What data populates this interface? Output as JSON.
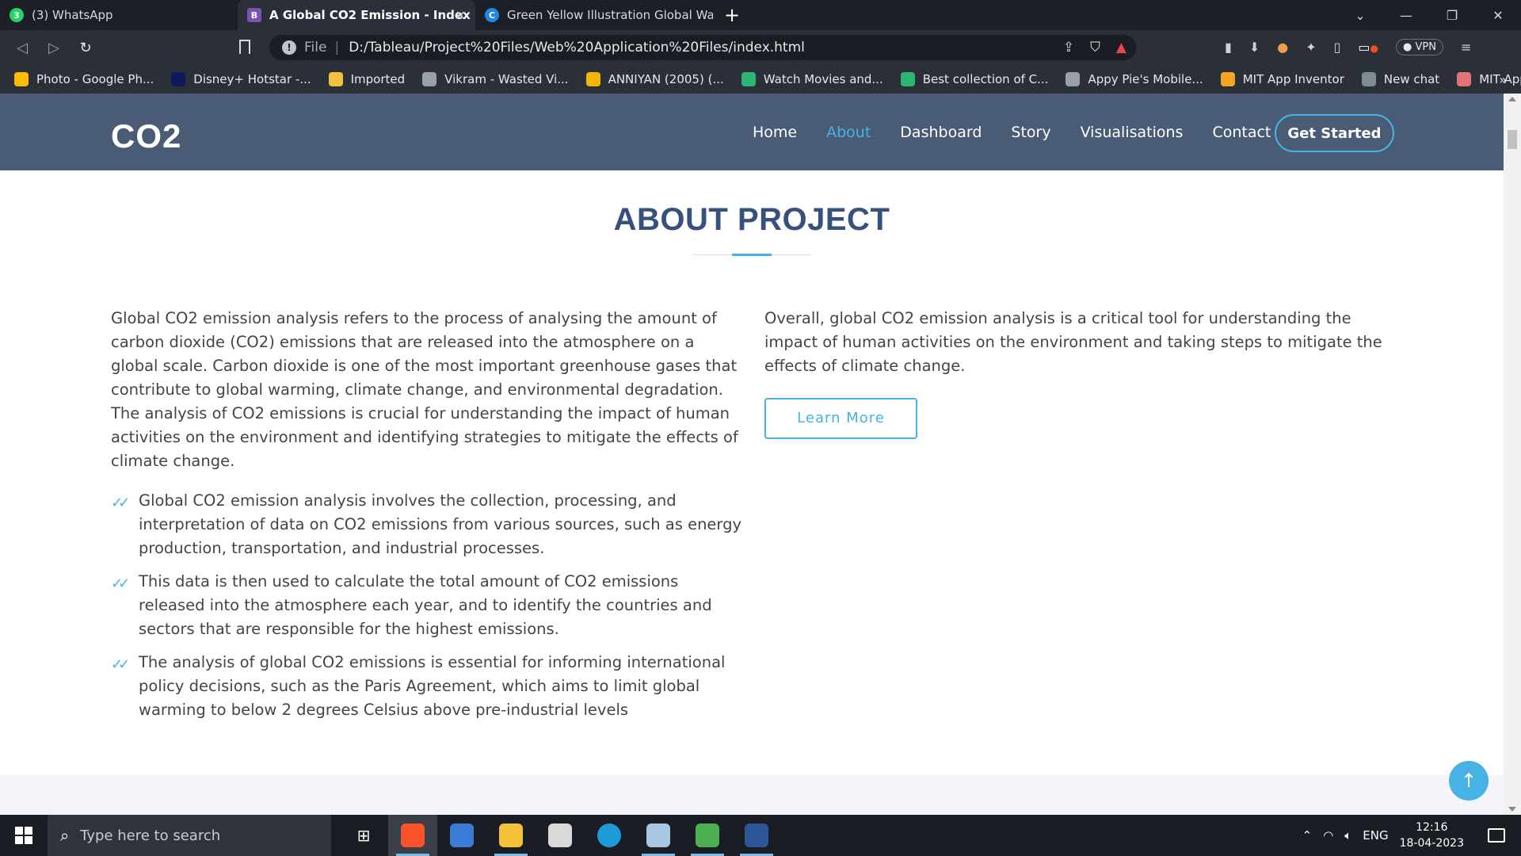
{
  "browser": {
    "tabs": [
      {
        "label": "(3) WhatsApp",
        "icon": "whatsapp-icon",
        "color": "#25d366",
        "glyph": "3"
      },
      {
        "label": "A Global CO2 Emission - Index",
        "icon": "bootstrap-icon",
        "color": "#7952b3",
        "glyph": "B",
        "active": true
      },
      {
        "label": "Green Yellow Illustration Global Warmi",
        "icon": "canva-icon",
        "color": "#1e88e5",
        "glyph": "C"
      }
    ],
    "new_tab": "+",
    "url_scheme": "File",
    "url": "D:/Tableau/Project%20Files/Web%20Application%20Files/index.html",
    "vpn_label": "VPN",
    "bookmarks": [
      {
        "label": "Photo - Google Ph...",
        "color": "#fbbc04"
      },
      {
        "label": "Disney+ Hotstar -...",
        "color": "#0f1a5a"
      },
      {
        "label": "Imported",
        "color": "#f3c13a"
      },
      {
        "label": "Vikram - Wasted Vi...",
        "color": "#9aa0a8"
      },
      {
        "label": "ANNIYAN (2005) (...",
        "color": "#f2b705"
      },
      {
        "label": "Watch Movies and...",
        "color": "#2bb673"
      },
      {
        "label": "Best collection of C...",
        "color": "#2bb673"
      },
      {
        "label": "Appy Pie's Mobile...",
        "color": "#9aa0a8"
      },
      {
        "label": "MIT App Inventor",
        "color": "#f4a523"
      },
      {
        "label": "New chat",
        "color": "#7f8c8d"
      },
      {
        "label": "MIT App Inventor",
        "color": "#e57373"
      }
    ],
    "bookmarks_more": "»"
  },
  "site": {
    "logo": "CO2",
    "nav": [
      {
        "label": "Home",
        "active": false
      },
      {
        "label": "About",
        "active": true
      },
      {
        "label": "Dashboard",
        "active": false
      },
      {
        "label": "Story",
        "active": false
      },
      {
        "label": "Visualisations",
        "active": false
      },
      {
        "label": "Contact",
        "active": false
      }
    ],
    "cta": "Get Started",
    "accent_color": "#47b2e4",
    "header_color": "#4a5b76"
  },
  "about": {
    "title": "ABOUT PROJECT",
    "intro": "Global CO2 emission analysis refers to the process of analysing the amount of carbon dioxide (CO2) emissions that are released into the atmosphere on a global scale. Carbon dioxide is one of the most important greenhouse gases that contribute to global warming, climate change, and environmental degradation. The analysis of CO2 emissions is crucial for understanding the impact of human activities on the environment and identifying strategies to mitigate the effects of climate change.",
    "bullets": [
      "Global CO2 emission analysis involves the collection, processing, and interpretation of data on CO2 emissions from various sources, such as energy production, transportation, and industrial processes.",
      "This data is then used to calculate the total amount of CO2 emissions released into the atmosphere each year, and to identify the countries and sectors that are responsible for the highest emissions.",
      "The analysis of global CO2 emissions is essential for informing international policy decisions, such as the Paris Agreement, which aims to limit global warming to below 2 degrees Celsius above pre-industrial levels"
    ],
    "conclusion": "Overall, global CO2 emission analysis is a critical tool for understanding the impact of human activities on the environment and taking steps to mitigate the effects of climate change.",
    "learn_more": "Learn More"
  },
  "taskbar": {
    "search_placeholder": "Type here to search",
    "language": "ENG",
    "time": "12:16",
    "date": "18-04-2023"
  }
}
